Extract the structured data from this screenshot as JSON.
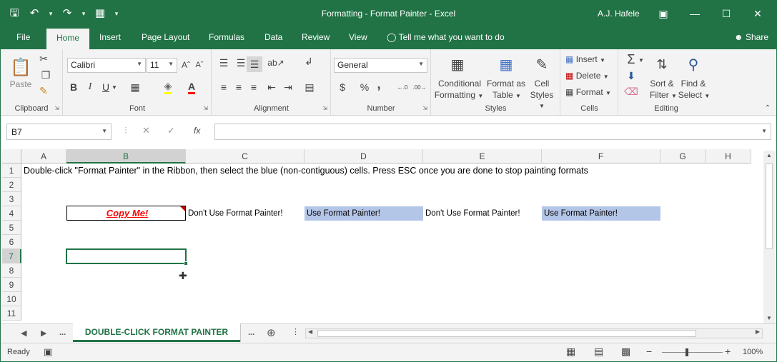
{
  "window": {
    "title": "Formatting - Format Painter  -  Excel",
    "user": "A.J. Hafele",
    "qat": {
      "save_icon": "save-icon",
      "undo_icon": "undo-icon",
      "redo_icon": "redo-icon",
      "custom_icon": "grid-icon"
    }
  },
  "tabs": [
    "File",
    "Home",
    "Insert",
    "Page Layout",
    "Formulas",
    "Data",
    "Review",
    "View"
  ],
  "tell_me": "Tell me what you want to do",
  "share": "Share",
  "ribbon": {
    "clipboard": {
      "label": "Clipboard",
      "paste": "Paste"
    },
    "font": {
      "label": "Font",
      "name": "Calibri",
      "size": "11",
      "bold": "B",
      "italic": "I",
      "underline": "U"
    },
    "alignment": {
      "label": "Alignment"
    },
    "number": {
      "label": "Number",
      "format": "General",
      "currency": "$",
      "percent": "%",
      "comma": ","
    },
    "styles": {
      "label": "Styles",
      "conditional_1": "Conditional",
      "conditional_2": "Formatting",
      "format_table_1": "Format as",
      "format_table_2": "Table",
      "cell_styles_1": "Cell",
      "cell_styles_2": "Styles"
    },
    "cells": {
      "label": "Cells",
      "insert": "Insert",
      "delete": "Delete",
      "format": "Format"
    },
    "editing": {
      "label": "Editing",
      "sort_1": "Sort &",
      "sort_2": "Filter",
      "find_1": "Find &",
      "find_2": "Select"
    }
  },
  "formula_bar": {
    "name_box": "B7",
    "fx": "fx",
    "content": ""
  },
  "columns": [
    "A",
    "B",
    "C",
    "D",
    "E",
    "F",
    "G",
    "H"
  ],
  "rows": [
    "1",
    "2",
    "3",
    "4",
    "5",
    "6",
    "7",
    "8",
    "9",
    "10",
    "11"
  ],
  "cells": {
    "A1": "Double-click \"Format Painter\" in the Ribbon, then select the blue (non-contiguous) cells.  Press ESC once you are done to stop painting formats",
    "B4": "Copy Me!",
    "C4": "Don't Use Format Painter!",
    "D4": "Use Format Painter!",
    "E4": "Don't Use Format Painter!",
    "F4": "Use Format Painter!"
  },
  "colors": {
    "accent": "#217346",
    "blue_fill": "#b4c6e7",
    "copy_text": "#ff0000"
  },
  "sheet_tabs": {
    "active": "DOUBLE-CLICK FORMAT PAINTER",
    "more_left": "...",
    "more_right": "..."
  },
  "status": {
    "mode": "Ready",
    "zoom": "100%",
    "zoom_level_percent": 100
  }
}
